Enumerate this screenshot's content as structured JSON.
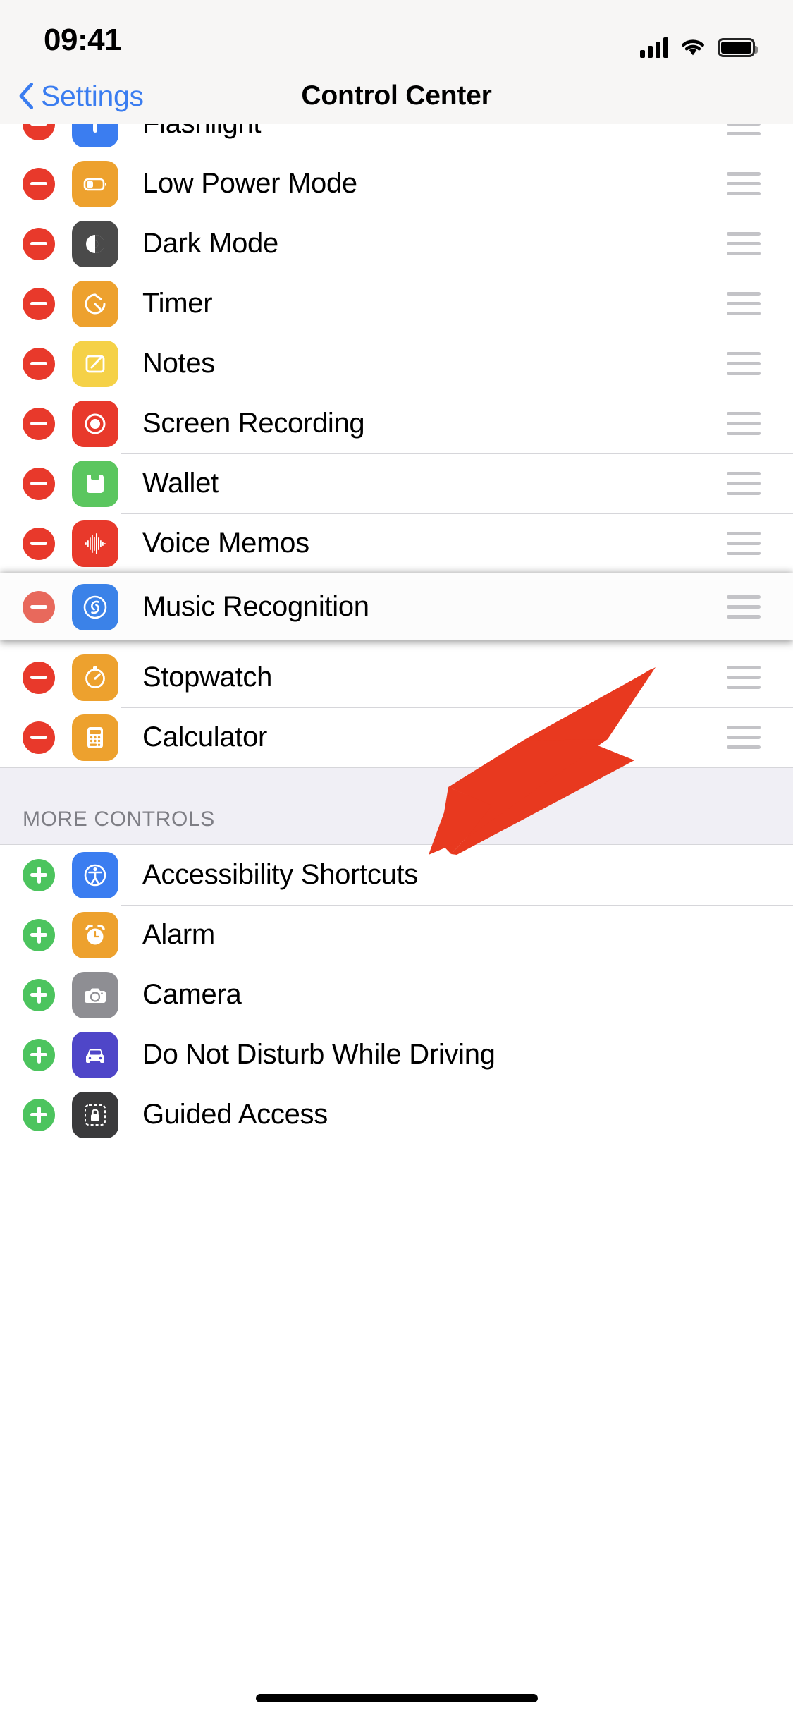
{
  "status_bar": {
    "time": "09:41",
    "cellular_icon": "cellular-bars-icon",
    "wifi_icon": "wifi-icon",
    "battery_icon": "battery-full-icon"
  },
  "nav": {
    "back_label": "Settings",
    "back_icon": "chevron-left-icon",
    "title": "Control Center"
  },
  "sections": [
    {
      "id": "included-controls",
      "header": null,
      "items": [
        {
          "label": "Flashlight",
          "icon": "flashlight-icon",
          "icon_bg": "#3b7df0",
          "control": "remove",
          "handle": true,
          "partial": true
        },
        {
          "label": "Low Power Mode",
          "icon": "low-power-battery-icon",
          "icon_bg": "#eda12e",
          "control": "remove",
          "handle": true
        },
        {
          "label": "Dark Mode",
          "icon": "dark-mode-circle-icon",
          "icon_bg": "#4a4a4a",
          "control": "remove",
          "handle": true
        },
        {
          "label": "Timer",
          "icon": "timer-icon",
          "icon_bg": "#eda12e",
          "control": "remove",
          "handle": true
        },
        {
          "label": "Notes",
          "icon": "notes-pencil-icon",
          "icon_bg": "#f5d147",
          "control": "remove",
          "handle": true
        },
        {
          "label": "Screen Recording",
          "icon": "record-circle-icon",
          "icon_bg": "#e8392b",
          "control": "remove",
          "handle": true
        },
        {
          "label": "Wallet",
          "icon": "wallet-card-icon",
          "icon_bg": "#5bc65f",
          "control": "remove",
          "handle": true
        },
        {
          "label": "Voice Memos",
          "icon": "waveform-icon",
          "icon_bg": "#e8392b",
          "control": "remove",
          "handle": true
        },
        {
          "label": "Music Recognition",
          "icon": "shazam-icon",
          "icon_bg": "#3b82e8",
          "control": "remove",
          "handle": true,
          "dragging": true
        },
        {
          "label": "Stopwatch",
          "icon": "stopwatch-icon",
          "icon_bg": "#eda12e",
          "control": "remove",
          "handle": true
        },
        {
          "label": "Calculator",
          "icon": "calculator-icon",
          "icon_bg": "#eda12e",
          "control": "remove",
          "handle": true
        }
      ]
    },
    {
      "id": "more-controls",
      "header": "MORE CONTROLS",
      "items": [
        {
          "label": "Accessibility Shortcuts",
          "icon": "accessibility-icon",
          "icon_bg": "#3b7df0",
          "control": "add"
        },
        {
          "label": "Alarm",
          "icon": "alarm-clock-icon",
          "icon_bg": "#eda12e",
          "control": "add"
        },
        {
          "label": "Camera",
          "icon": "camera-icon",
          "icon_bg": "#8e8e93",
          "control": "add"
        },
        {
          "label": "Do Not Disturb While Driving",
          "icon": "car-icon",
          "icon_bg": "#4f46c8",
          "control": "add"
        },
        {
          "label": "Guided Access",
          "icon": "guided-access-lock-icon",
          "icon_bg": "#3a3a3c",
          "control": "add",
          "partial_bottom": true
        }
      ]
    }
  ],
  "annotation": {
    "type": "arrow",
    "color": "#e8391f",
    "points_to": "Music Recognition"
  },
  "colors": {
    "accent_blue": "#3b7df0",
    "remove_red": "#e8392b",
    "add_green": "#4cc45e",
    "separator": "#d6d6da",
    "section_bg": "#f0eff5",
    "chrome_bg": "#f7f6f5"
  }
}
